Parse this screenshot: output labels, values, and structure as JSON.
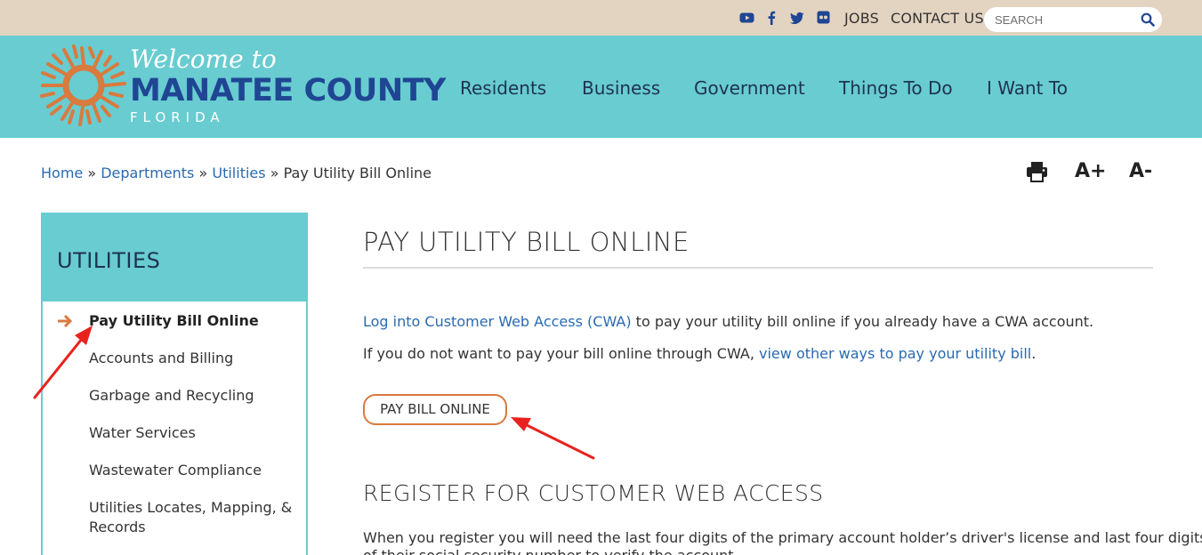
{
  "topbar": {
    "social_icons": [
      "youtube-icon",
      "facebook-icon",
      "twitter-icon",
      "flickr-icon"
    ],
    "jobs_label": "JOBS",
    "contact_label": "CONTACT US",
    "search_placeholder": "SEARCH"
  },
  "header": {
    "logo_welcome": "Welcome to",
    "logo_county": "MANATEE COUNTY",
    "logo_state": "FLORIDA",
    "nav": [
      "Residents",
      "Business",
      "Government",
      "Things To Do",
      "I Want To"
    ]
  },
  "breadcrumb": {
    "items": [
      "Home",
      "Departments",
      "Utilities"
    ],
    "separator": "»",
    "current": "Pay Utility Bill Online"
  },
  "tools": {
    "print_icon": "print-icon",
    "increase_label": "A+",
    "decrease_label": "A-"
  },
  "sidebar": {
    "title": "UTILITIES",
    "items": [
      "Pay Utility Bill Online",
      "Accounts and Billing",
      "Garbage and Recycling",
      "Water Services",
      "Wastewater Compliance",
      "Utilities Locates, Mapping, &",
      "Records"
    ]
  },
  "main": {
    "title": "PAY UTILITY BILL ONLINE",
    "p1_link": "Log into Customer Web Access (CWA)",
    "p1_text": " to pay your utility bill online if you already have a CWA account.",
    "p2_text": "If you do not want to pay your bill online through CWA, ",
    "p2_link": "view other ways to pay your utility bill",
    "p2_end": ".",
    "pay_button": "PAY BILL ONLINE",
    "section_title": "REGISTER FOR CUSTOMER WEB ACCESS",
    "p3_text": "When you register you will need the last four digits of the primary account holder’s driver's license and last four digits",
    "p4_text": "of their social security number to verify the account."
  },
  "colors": {
    "topbar": "#e3d3c1",
    "header": "#68ccd1",
    "county_blue": "#1f4693",
    "link": "#2a6ab0",
    "accent_orange": "#d97a3e",
    "annotation_red": "#e8231f"
  }
}
